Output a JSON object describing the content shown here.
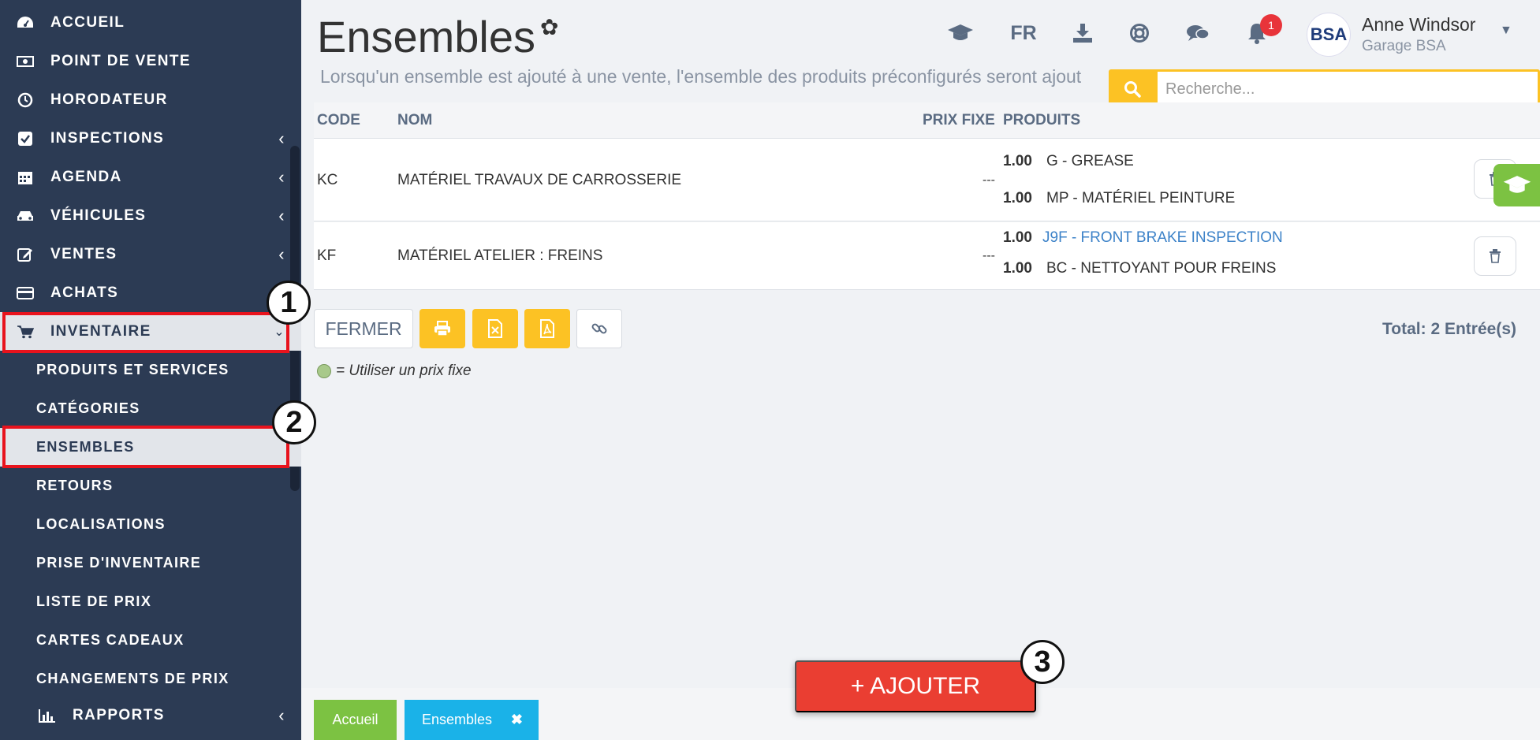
{
  "sidebar": {
    "items": [
      {
        "label": "ACCUEIL",
        "icon": "dashboard-icon"
      },
      {
        "label": "POINT DE VENTE",
        "icon": "cash-icon"
      },
      {
        "label": "HORODATEUR",
        "icon": "clock-icon"
      },
      {
        "label": "INSPECTIONS",
        "icon": "checkbox-icon",
        "has_submenu": true
      },
      {
        "label": "AGENDA",
        "icon": "calendar-icon",
        "has_submenu": true
      },
      {
        "label": "VÉHICULES",
        "icon": "car-icon",
        "has_submenu": true
      },
      {
        "label": "VENTES",
        "icon": "edit-icon",
        "has_submenu": true
      },
      {
        "label": "ACHATS",
        "icon": "credit-card-icon"
      },
      {
        "label": "INVENTAIRE",
        "icon": "cart-icon",
        "has_submenu": true,
        "expanded": true
      }
    ],
    "subitems": [
      {
        "label": "PRODUITS ET SERVICES"
      },
      {
        "label": "CATÉGORIES"
      },
      {
        "label": "ENSEMBLES",
        "active": true
      },
      {
        "label": "RETOURS"
      },
      {
        "label": "LOCALISATIONS"
      },
      {
        "label": "PRISE D'INVENTAIRE"
      },
      {
        "label": "LISTE DE PRIX"
      },
      {
        "label": "CARTES CADEAUX"
      },
      {
        "label": "CHANGEMENTS DE PRIX"
      }
    ],
    "rapports": {
      "label": "RAPPORTS",
      "icon": "bar-chart-icon"
    }
  },
  "callouts": [
    "1",
    "2",
    "3"
  ],
  "header": {
    "title": "Ensembles",
    "subtitle": "Lorsqu'un ensemble est ajouté à une vente, l'ensemble des produits préconfigurés seront ajout",
    "language": "FR",
    "notifications_count": "1",
    "user_name": "Anne Windsor",
    "user_company": "Garage BSA",
    "avatar_text": "BSA"
  },
  "search": {
    "placeholder": "Recherche..."
  },
  "table": {
    "columns": {
      "code": "CODE",
      "nom": "NOM",
      "prix_fixe": "PRIX FIXE",
      "produits": "PRODUITS"
    },
    "rows": [
      {
        "code": "KC",
        "nom": "MATÉRIEL TRAVAUX DE CARROSSERIE",
        "prix_fixe": "---",
        "produits": [
          {
            "qty": "1.00",
            "name": "G - GREASE"
          },
          {
            "qty": "1.00",
            "name": "MP - MATÉRIEL PEINTURE"
          }
        ]
      },
      {
        "code": "KF",
        "nom": "MATÉRIEL ATELIER : FREINS",
        "prix_fixe": "---",
        "produits": [
          {
            "qty": "1.00",
            "name": "J9F - FRONT BRAKE INSPECTION"
          },
          {
            "qty": "1.00",
            "name": "BC - NETTOYANT POUR FREINS"
          }
        ]
      }
    ]
  },
  "toolbar": {
    "close_label": "FERMER"
  },
  "total": "Total: 2 Entrée(s)",
  "legend": "= Utiliser un prix fixe",
  "add_button": "+ AJOUTER",
  "bottom_tabs": {
    "home": "Accueil",
    "current": "Ensembles",
    "close_glyph": "✖"
  },
  "colors": {
    "sidebar": "#2c3b54",
    "accent_yellow": "#fcc224",
    "add_red": "#ea3e32",
    "tab_green": "#7cc242",
    "tab_blue": "#1ab2e8",
    "highlight": "#e8131d"
  }
}
